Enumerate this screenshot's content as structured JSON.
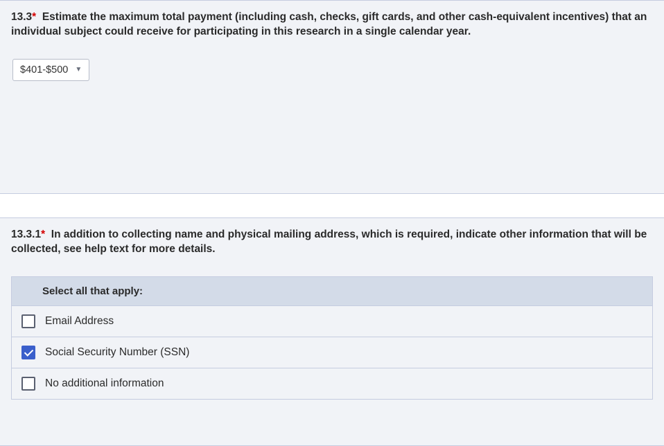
{
  "q1": {
    "number": "13.3",
    "required_mark": "*",
    "text": "Estimate the maximum total payment (including cash, checks, gift cards, and other cash-equivalent incentives) that an individual subject could receive for participating in this research in a single calendar year.",
    "dropdown_value": "$401-$500"
  },
  "q2": {
    "number": "13.3.1",
    "required_mark": "*",
    "text": "In addition to collecting name and physical mailing address, which is required, indicate other information that will be collected, see help text for more details.",
    "header": "Select all that apply:",
    "options": [
      {
        "label": "Email Address",
        "checked": false
      },
      {
        "label": "Social Security Number (SSN)",
        "checked": true
      },
      {
        "label": "No additional information",
        "checked": false
      }
    ]
  }
}
